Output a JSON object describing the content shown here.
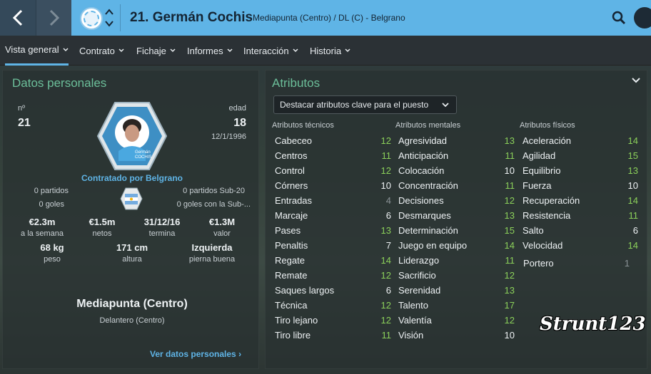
{
  "header": {
    "title": "21. Germán Cochis",
    "subtitle": "Mediapunta (Centro) / DL (C) - Belgrano"
  },
  "tabs": [
    {
      "label": "Vista general",
      "active": true
    },
    {
      "label": "Contrato"
    },
    {
      "label": "Fichaje"
    },
    {
      "label": "Informes"
    },
    {
      "label": "Interacción"
    },
    {
      "label": "Historia"
    }
  ],
  "personal": {
    "title": "Datos personales",
    "number_label": "nº",
    "number": "21",
    "age_label": "edad",
    "age": "18",
    "dob": "12/1/1996",
    "portrait_caption": "Germán COCHIS",
    "contracted": "Contratado por Belgrano",
    "matches": "0 partidos",
    "goals": "0 goles",
    "matches_u20": "0 partidos Sub-20",
    "goals_u20": "0 goles con la Sub-...",
    "wage_value": "€2.3m",
    "wage_label": "a la semana",
    "net_value": "€1.5m",
    "net_label": "netos",
    "expiry_value": "31/12/16",
    "expiry_label": "termina",
    "worth_value": "€1.3M",
    "worth_label": "valor",
    "weight_value": "68 kg",
    "weight_label": "peso",
    "height_value": "171 cm",
    "height_label": "altura",
    "foot_value": "Izquierda",
    "foot_label": "pierna buena",
    "position": "Mediapunta (Centro)",
    "role": "Delantero (Centro)",
    "link": "Ver datos personales"
  },
  "attributes": {
    "title": "Atributos",
    "dropdown": "Destacar atributos clave para el puesto",
    "technical": {
      "heading": "Atributos técnicos",
      "items": [
        {
          "name": "Cabeceo",
          "value": "12",
          "tone": "green"
        },
        {
          "name": "Centros",
          "value": "11",
          "tone": "green"
        },
        {
          "name": "Control",
          "value": "12",
          "tone": "green"
        },
        {
          "name": "Córners",
          "value": "10",
          "tone": "white"
        },
        {
          "name": "Entradas",
          "value": "4",
          "tone": "gray"
        },
        {
          "name": "Marcaje",
          "value": "6",
          "tone": "white"
        },
        {
          "name": "Pases",
          "value": "13",
          "tone": "green"
        },
        {
          "name": "Penaltis",
          "value": "7",
          "tone": "white"
        },
        {
          "name": "Regate",
          "value": "14",
          "tone": "green"
        },
        {
          "name": "Remate",
          "value": "12",
          "tone": "green"
        },
        {
          "name": "Saques largos",
          "value": "6",
          "tone": "white"
        },
        {
          "name": "Técnica",
          "value": "12",
          "tone": "green"
        },
        {
          "name": "Tiro lejano",
          "value": "12",
          "tone": "green"
        },
        {
          "name": "Tiro libre",
          "value": "11",
          "tone": "green"
        }
      ]
    },
    "mental": {
      "heading": "Atributos mentales",
      "items": [
        {
          "name": "Agresividad",
          "value": "13",
          "tone": "green"
        },
        {
          "name": "Anticipación",
          "value": "11",
          "tone": "green"
        },
        {
          "name": "Colocación",
          "value": "10",
          "tone": "white"
        },
        {
          "name": "Concentración",
          "value": "11",
          "tone": "green"
        },
        {
          "name": "Decisiones",
          "value": "12",
          "tone": "green"
        },
        {
          "name": "Desmarques",
          "value": "13",
          "tone": "green"
        },
        {
          "name": "Determinación",
          "value": "15",
          "tone": "green"
        },
        {
          "name": "Juego en equipo",
          "value": "14",
          "tone": "green"
        },
        {
          "name": "Liderazgo",
          "value": "11",
          "tone": "green"
        },
        {
          "name": "Sacrificio",
          "value": "12",
          "tone": "green"
        },
        {
          "name": "Serenidad",
          "value": "13",
          "tone": "green"
        },
        {
          "name": "Talento",
          "value": "17",
          "tone": "green"
        },
        {
          "name": "Valentía",
          "value": "12",
          "tone": "green"
        },
        {
          "name": "Visión",
          "value": "10",
          "tone": "white"
        }
      ]
    },
    "physical": {
      "heading": "Atributos físicos",
      "items": [
        {
          "name": "Aceleración",
          "value": "14",
          "tone": "green"
        },
        {
          "name": "Agilidad",
          "value": "15",
          "tone": "green"
        },
        {
          "name": "Equilibrio",
          "value": "13",
          "tone": "green"
        },
        {
          "name": "Fuerza",
          "value": "10",
          "tone": "white"
        },
        {
          "name": "Recuperación",
          "value": "14",
          "tone": "green"
        },
        {
          "name": "Resistencia",
          "value": "11",
          "tone": "green"
        },
        {
          "name": "Salto",
          "value": "6",
          "tone": "white"
        },
        {
          "name": "Velocidad",
          "value": "14",
          "tone": "green"
        }
      ],
      "goalkeeper": {
        "name": "Portero",
        "value": "1",
        "tone": "gray"
      }
    }
  },
  "watermark": "Strunt123",
  "colors": {
    "accent": "#5fb4e6",
    "good": "#8bd05a",
    "section_title": "#6cbf9a"
  }
}
